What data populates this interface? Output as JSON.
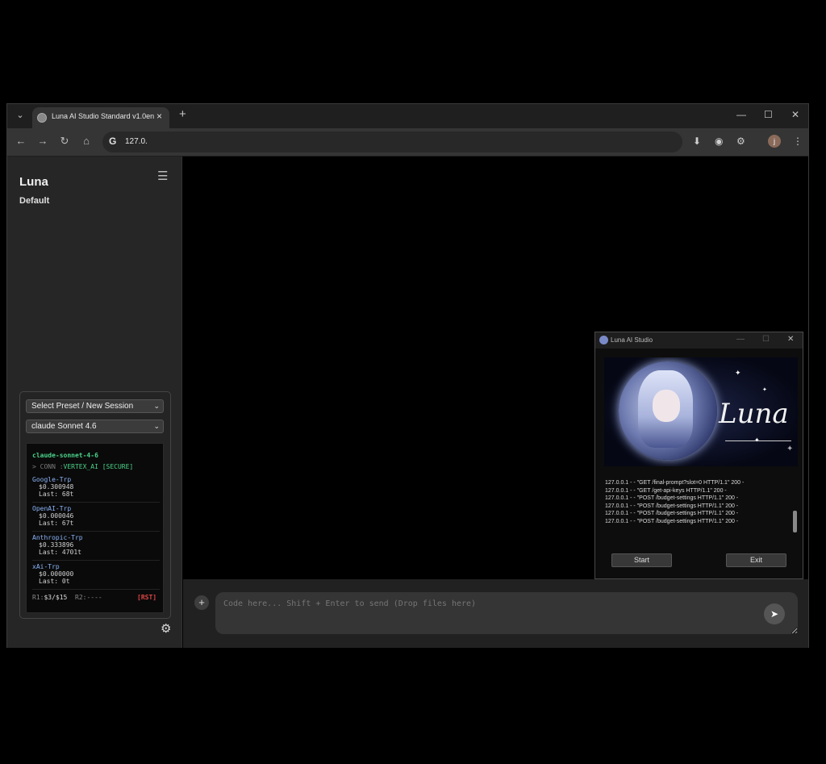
{
  "browser": {
    "tab_title": "Luna AI Studio Standard v1.0en",
    "url": "127.0.",
    "avatar_initial": "j"
  },
  "sidebar": {
    "title": "Luna",
    "subtitle": "Default",
    "preset_select": "Select Preset / New Session",
    "model_select": "claude Sonnet 4.6"
  },
  "terminal": {
    "model": "claude-sonnet-4-6",
    "conn_prefix": "> CONN :",
    "conn_value": "VERTEX_AI [SECURE]",
    "providers": [
      {
        "name": "Google-Trp",
        "cost": "$0.300948",
        "last": "Last: 68t"
      },
      {
        "name": "OpenAI-Trp",
        "cost": "$0.000046",
        "last": "Last: 67t"
      },
      {
        "name": "Anthropic-Trp",
        "cost": "$0.333896",
        "last": "Last: 4701t"
      },
      {
        "name": "xAi-Trp",
        "cost": "$0.000000",
        "last": "Last: 0t"
      }
    ],
    "r1_label": "R1:",
    "r1_value": "$3/$15",
    "r2_label": "R2:----",
    "reset": "[RST]"
  },
  "chat": {
    "placeholder": "Code here... Shift + Enter to send (Drop files here)"
  },
  "popup": {
    "title": "Luna AI Studio",
    "banner_text": "Luna",
    "log_lines": [
      "127.0.0.1 - - \"GET /final-prompt?slot=0 HTTP/1.1\" 200 -",
      "127.0.0.1 - - \"GET /get-api-keys HTTP/1.1\" 200 -",
      "127.0.0.1 - - \"POST /budget-settings HTTP/1.1\" 200 -",
      "127.0.0.1 - - \"POST /budget-settings HTTP/1.1\" 200 -",
      "127.0.0.1 - - \"POST /budget-settings HTTP/1.1\" 200 -",
      "127.0.0.1 - - \"POST /budget-settings HTTP/1.1\" 200 -"
    ],
    "start_label": "Start",
    "exit_label": "Exit"
  },
  "icons": {
    "tab_dropdown": "chevron-down-icon",
    "back": "back-arrow-icon",
    "forward": "forward-arrow-icon",
    "reload": "reload-icon",
    "home": "home-icon",
    "menu": "hamburger-icon",
    "settings": "gear-icon",
    "send": "send-icon"
  }
}
